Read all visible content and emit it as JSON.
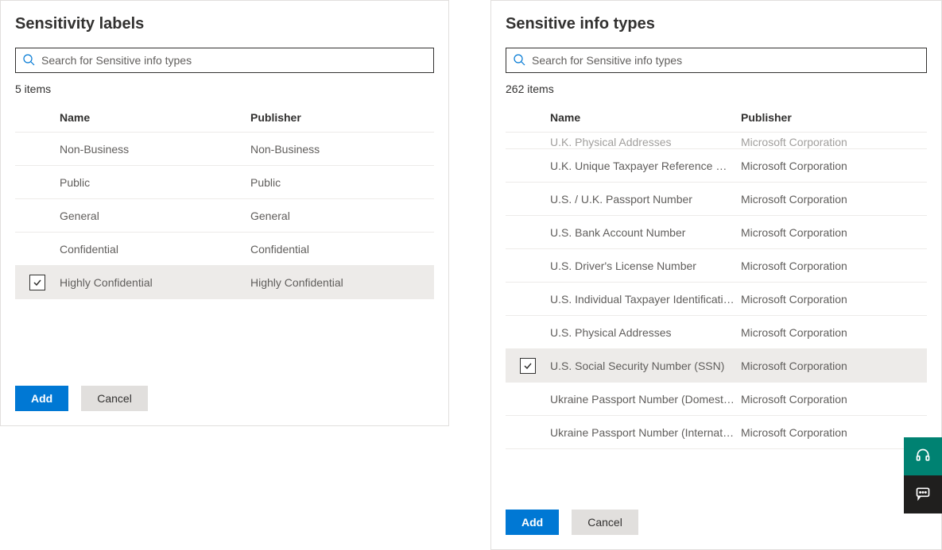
{
  "left_panel": {
    "title": "Sensitivity labels",
    "search_placeholder": "Search for Sensitive info types",
    "count_text": "5 items",
    "col_name": "Name",
    "col_publisher": "Publisher",
    "rows": [
      {
        "name": "Non-Business",
        "publisher": "Non-Business",
        "selected": false
      },
      {
        "name": "Public",
        "publisher": "Public",
        "selected": false
      },
      {
        "name": "General",
        "publisher": "General",
        "selected": false
      },
      {
        "name": "Confidential",
        "publisher": "Confidential",
        "selected": false
      },
      {
        "name": "Highly Confidential",
        "publisher": "Highly Confidential",
        "selected": true
      }
    ],
    "add_label": "Add",
    "cancel_label": "Cancel"
  },
  "right_panel": {
    "title": "Sensitive info types",
    "search_placeholder": "Search for Sensitive info types",
    "count_text": "262 items",
    "col_name": "Name",
    "col_publisher": "Publisher",
    "partial_row": {
      "name": "U.K. Physical Addresses",
      "publisher": "Microsoft Corporation"
    },
    "rows": [
      {
        "name": "U.K. Unique Taxpayer Reference Number",
        "publisher": "Microsoft Corporation",
        "selected": false
      },
      {
        "name": "U.S. / U.K. Passport Number",
        "publisher": "Microsoft Corporation",
        "selected": false
      },
      {
        "name": "U.S. Bank Account Number",
        "publisher": "Microsoft Corporation",
        "selected": false
      },
      {
        "name": "U.S. Driver's License Number",
        "publisher": "Microsoft Corporation",
        "selected": false
      },
      {
        "name": "U.S. Individual Taxpayer Identification N...",
        "publisher": "Microsoft Corporation",
        "selected": false
      },
      {
        "name": "U.S. Physical Addresses",
        "publisher": "Microsoft Corporation",
        "selected": false
      },
      {
        "name": "U.S. Social Security Number (SSN)",
        "publisher": "Microsoft Corporation",
        "selected": true
      },
      {
        "name": "Ukraine Passport Number (Domestic)",
        "publisher": "Microsoft Corporation",
        "selected": false
      },
      {
        "name": "Ukraine Passport Number (International)",
        "publisher": "Microsoft Corporation",
        "selected": false
      }
    ],
    "add_label": "Add",
    "cancel_label": "Cancel"
  }
}
